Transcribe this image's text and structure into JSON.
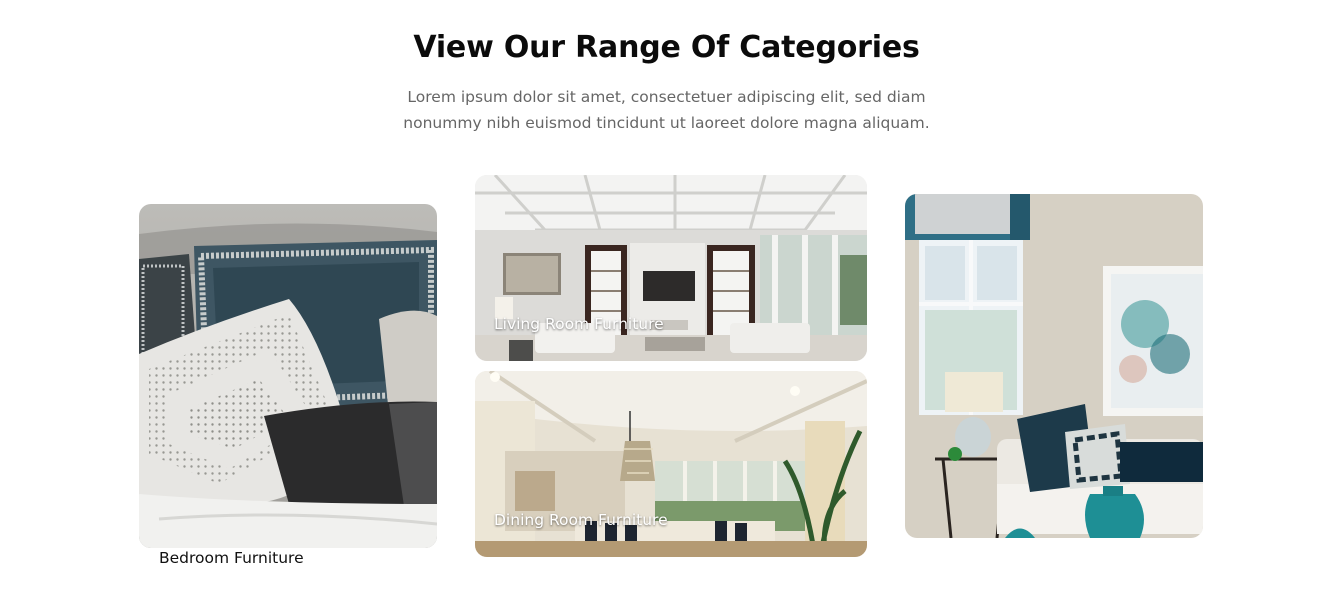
{
  "section": {
    "title": "View Our Range Of Categories",
    "description_line1": "Lorem ipsum dolor sit amet, consectetuer adipiscing elit, sed diam",
    "description_line2": "nonummy nibh euismod tincidunt ut laoreet dolore magna aliquam."
  },
  "categories": [
    {
      "label": "Bedroom Furniture",
      "image": "bedroom-pillows-photo"
    },
    {
      "label": "Living Room Furniture",
      "image": "living-room-photo"
    },
    {
      "label": "Dining Room Furniture",
      "image": "dining-room-photo"
    },
    {
      "label": "",
      "image": "lounge-sofa-window-photo"
    }
  ],
  "colors": {
    "title": "#0b0b0b",
    "description": "#666666",
    "label_on_image": "#ffffff",
    "accent_teal": "#1f6f7a"
  }
}
